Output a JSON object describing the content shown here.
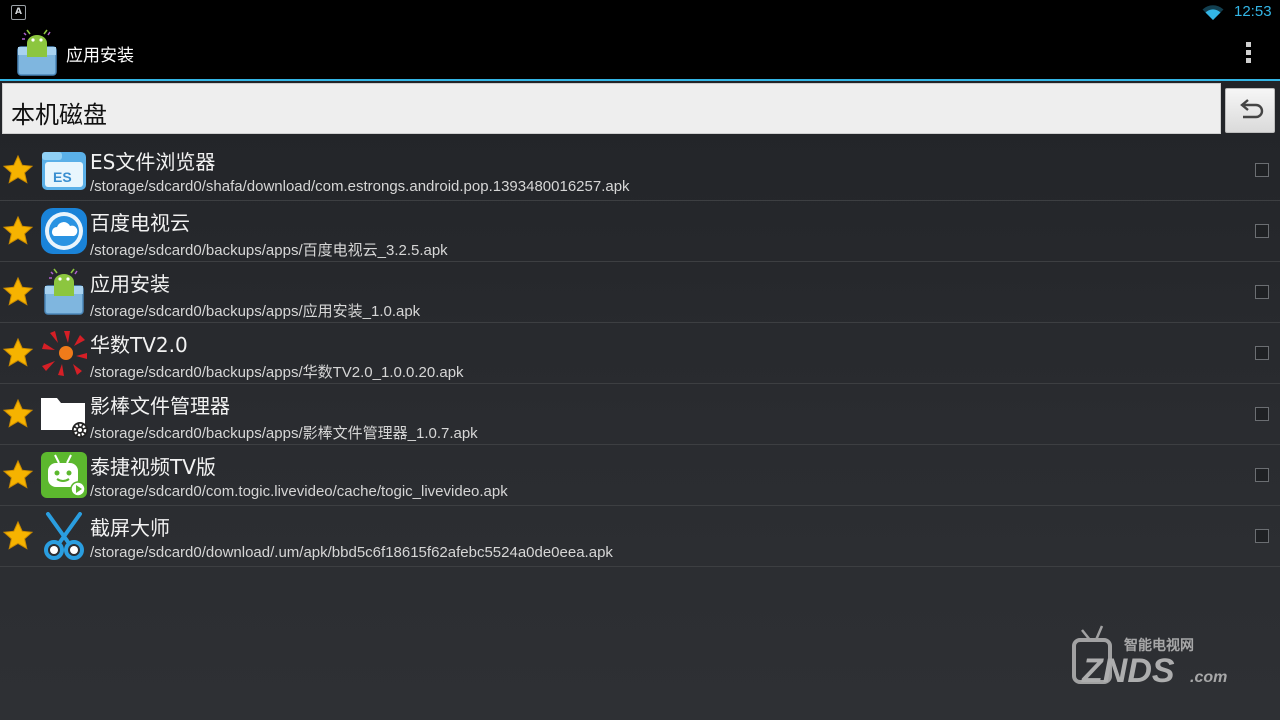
{
  "status_bar": {
    "notification_icon": "A",
    "time": "12:53",
    "wifi_icon": "wifi-icon",
    "accent_color": "#33b5e5"
  },
  "action_bar": {
    "title": "应用安装",
    "app_icon": "android-box-icon",
    "overflow_icon": "overflow-menu-icon"
  },
  "path_bar": {
    "path": "本机磁盘",
    "back_icon": "undo-icon"
  },
  "apk_list": [
    {
      "name": "ES文件浏览器",
      "path": "/storage/sdcard0/shafa/download/com.estrongs.android.pop.1393480016257.apk",
      "icon": "es-file-explorer-icon",
      "starred": true,
      "checked": false
    },
    {
      "name": "百度电视云",
      "path": "/storage/sdcard0/backups/apps/百度电视云_3.2.5.apk",
      "icon": "baidu-cloud-icon",
      "starred": true,
      "checked": false
    },
    {
      "name": "应用安装",
      "path": "/storage/sdcard0/backups/apps/应用安装_1.0.apk",
      "icon": "android-box-icon",
      "starred": true,
      "checked": false
    },
    {
      "name": "华数TV2.0",
      "path": "/storage/sdcard0/backups/apps/华数TV2.0_1.0.0.20.apk",
      "icon": "wasu-tv-icon",
      "starred": true,
      "checked": false
    },
    {
      "name": "影棒文件管理器",
      "path": "/storage/sdcard0/backups/apps/影棒文件管理器_1.0.7.apk",
      "icon": "folder-gear-icon",
      "starred": true,
      "checked": false
    },
    {
      "name": "泰捷视频TV版",
      "path": "/storage/sdcard0/com.togic.livevideo/cache/togic_livevideo.apk",
      "icon": "togic-tv-icon",
      "starred": true,
      "checked": false
    },
    {
      "name": "截屏大师",
      "path": "/storage/sdcard0/download/.um/apk/bbd5c6f18615f62afebc5524a0de0eea.apk",
      "icon": "scissors-icon",
      "starred": true,
      "checked": false
    }
  ],
  "watermark": {
    "top_text": "智能电视网",
    "brand": "ZNDS",
    "suffix": ".com"
  }
}
